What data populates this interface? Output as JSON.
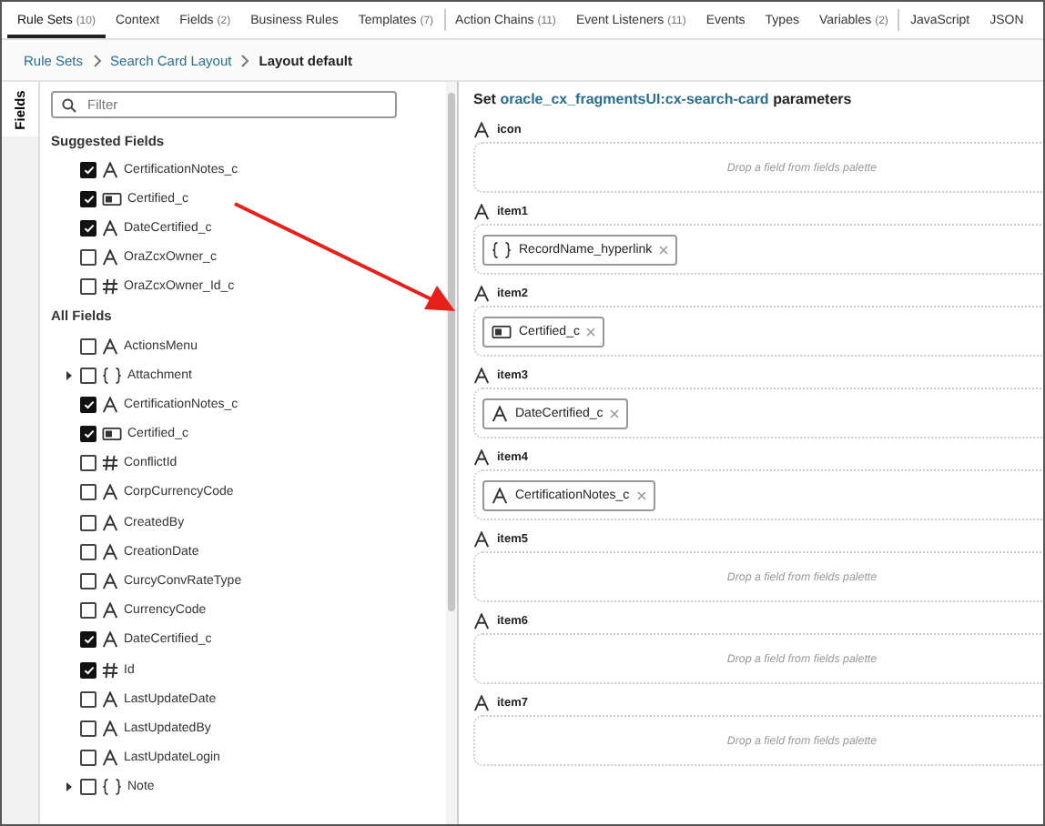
{
  "tabs": [
    {
      "label": "Rule Sets",
      "count": "(10)",
      "selected": true
    },
    {
      "label": "Context",
      "selected": false
    },
    {
      "label": "Fields",
      "count": "(2)",
      "selected": false
    },
    {
      "label": "Business Rules",
      "selected": false
    },
    {
      "label": "Templates",
      "count": "(7)",
      "selected": false
    },
    {
      "label": "Action Chains",
      "count": "(11)",
      "selected": false
    },
    {
      "label": "Event Listeners",
      "count": "(11)",
      "selected": false
    },
    {
      "label": "Events",
      "selected": false
    },
    {
      "label": "Types",
      "selected": false
    },
    {
      "label": "Variables",
      "count": "(2)",
      "selected": false
    },
    {
      "label": "JavaScript",
      "selected": false
    },
    {
      "label": "JSON",
      "selected": false
    }
  ],
  "breadcrumb": [
    {
      "label": "Rule Sets",
      "kind": "link"
    },
    {
      "label": "Search Card Layout",
      "kind": "link"
    },
    {
      "label": "Layout default",
      "kind": "current"
    }
  ],
  "side_tab": {
    "label": "Fields"
  },
  "filter": {
    "placeholder": "Filter"
  },
  "sections": [
    {
      "title": "Suggested Fields",
      "fields": [
        {
          "name": "CertificationNotes_c",
          "kind": "text",
          "checked": true
        },
        {
          "name": "Certified_c",
          "kind": "boolean",
          "checked": true
        },
        {
          "name": "DateCertified_c",
          "kind": "text",
          "checked": true
        },
        {
          "name": "OraZcxOwner_c",
          "kind": "text",
          "checked": false
        },
        {
          "name": "OraZcxOwner_Id_c",
          "kind": "number",
          "checked": false
        }
      ]
    },
    {
      "title": "All Fields",
      "fields": [
        {
          "name": "ActionsMenu",
          "kind": "text",
          "checked": false
        },
        {
          "name": "Attachment",
          "kind": "object",
          "checked": false,
          "expanded": false
        },
        {
          "name": "CertificationNotes_c",
          "kind": "text",
          "checked": true
        },
        {
          "name": "Certified_c",
          "kind": "boolean",
          "checked": true
        },
        {
          "name": "ConflictId",
          "kind": "number",
          "checked": false
        },
        {
          "name": "CorpCurrencyCode",
          "kind": "text",
          "checked": false
        },
        {
          "name": "CreatedBy",
          "kind": "text",
          "checked": false
        },
        {
          "name": "CreationDate",
          "kind": "text",
          "checked": false
        },
        {
          "name": "CurcyConvRateType",
          "kind": "text",
          "checked": false
        },
        {
          "name": "CurrencyCode",
          "kind": "text",
          "checked": false
        },
        {
          "name": "DateCertified_c",
          "kind": "text",
          "checked": true
        },
        {
          "name": "Id",
          "kind": "number",
          "checked": true
        },
        {
          "name": "LastUpdateDate",
          "kind": "text",
          "checked": false
        },
        {
          "name": "LastUpdatedBy",
          "kind": "text",
          "checked": false
        },
        {
          "name": "LastUpdateLogin",
          "kind": "text",
          "checked": false
        },
        {
          "name": "Note",
          "kind": "object",
          "checked": false,
          "expanded": false
        }
      ]
    }
  ],
  "heading": {
    "prefix": "Set",
    "component": "oracle_cx_fragmentsUI:cx-search-card",
    "suffix": "parameters"
  },
  "parameters": [
    {
      "name": "icon",
      "placeholder": "Drop a field from fields palette"
    },
    {
      "name": "item1",
      "value": {
        "name": "RecordName_hyperlink",
        "kind": "object"
      }
    },
    {
      "name": "item2",
      "value": {
        "name": "Certified_c",
        "kind": "boolean"
      }
    },
    {
      "name": "item3",
      "value": {
        "name": "DateCertified_c",
        "kind": "text"
      }
    },
    {
      "name": "item4",
      "value": {
        "name": "CertificationNotes_c",
        "kind": "text"
      }
    },
    {
      "name": "item5",
      "placeholder": "Drop a field from fields palette"
    },
    {
      "name": "item6",
      "placeholder": "Drop a field from fields palette"
    },
    {
      "name": "item7",
      "placeholder": "Drop a field from fields palette"
    }
  ]
}
